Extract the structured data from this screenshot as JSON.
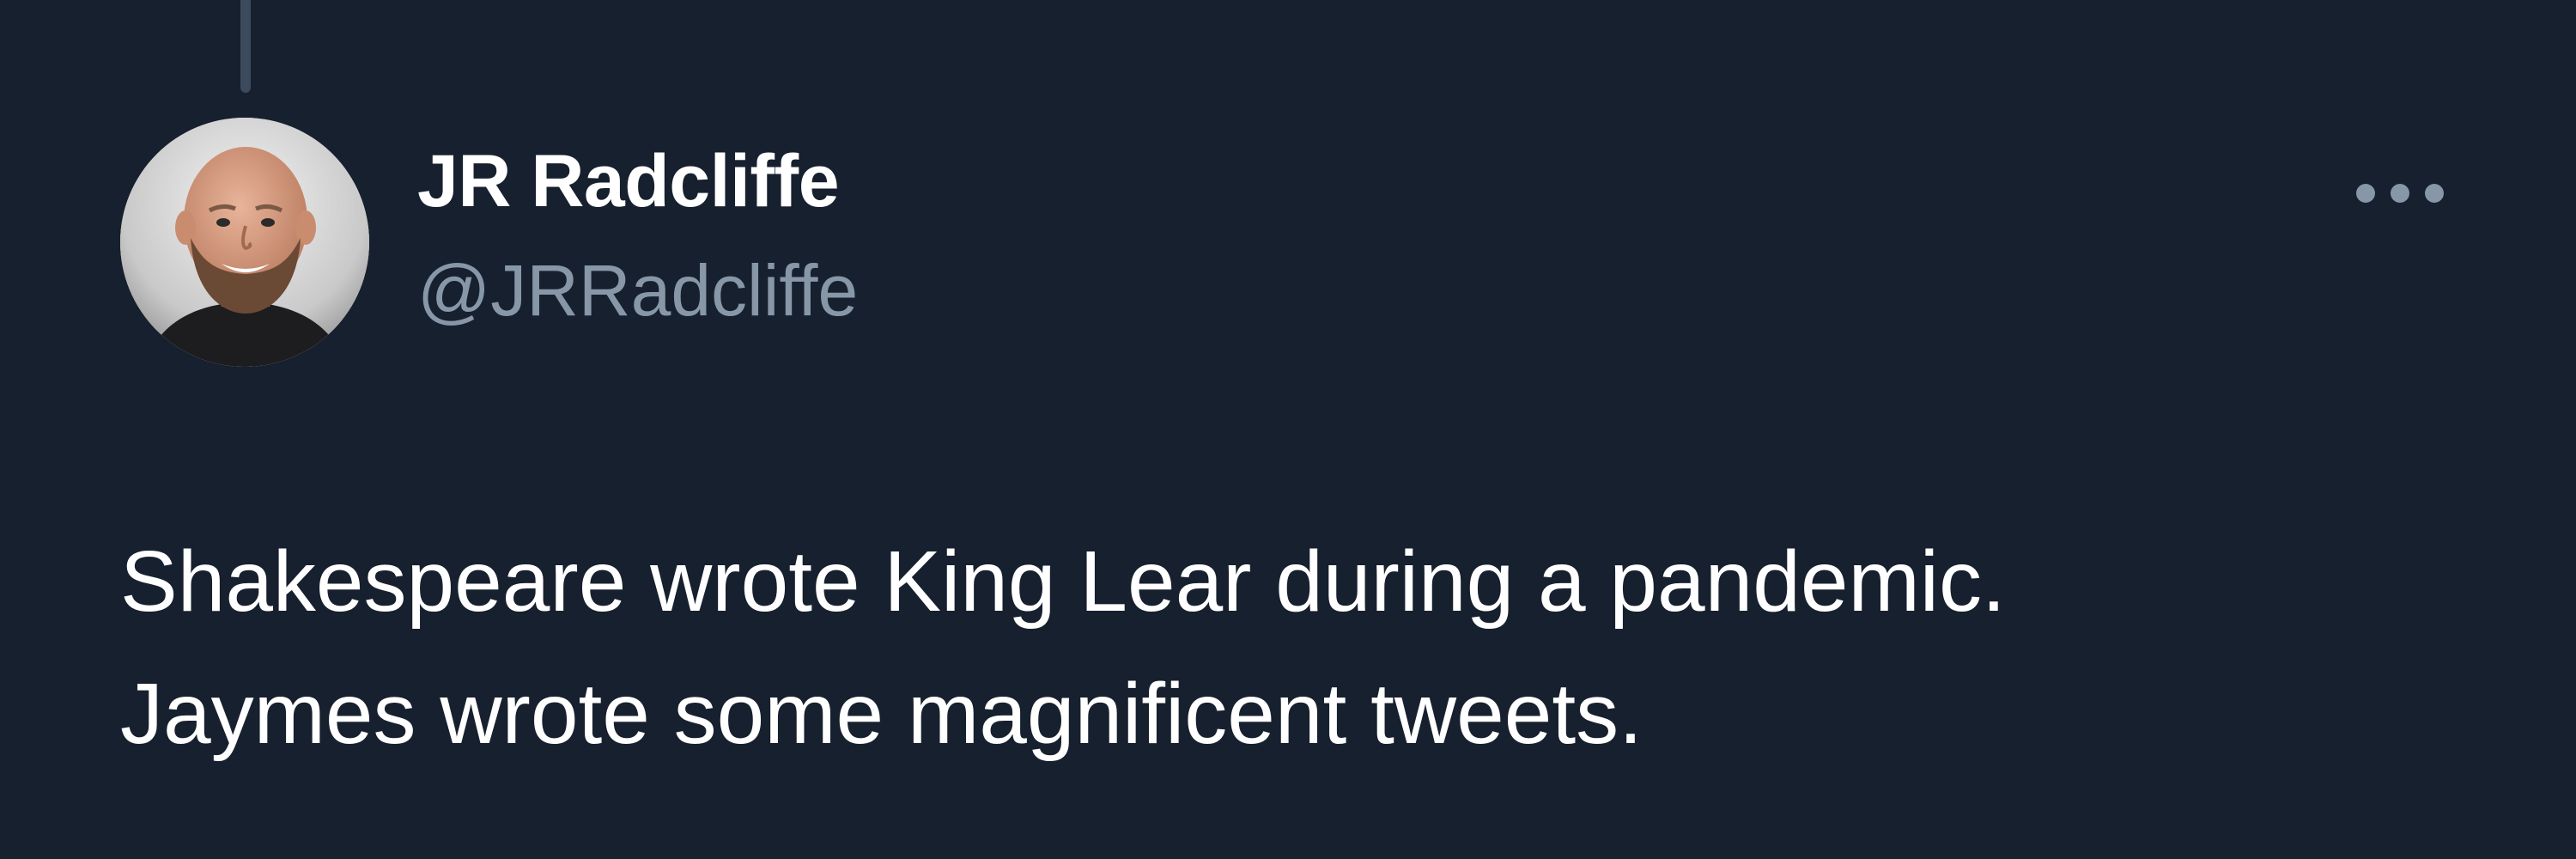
{
  "tweet": {
    "author": {
      "display_name": "JR Radcliffe",
      "handle": "@JRRadcliffe",
      "avatar_icon": "profile-photo"
    },
    "more_icon": "more-horizontal-icon",
    "text_lines": [
      "Shakespeare wrote King Lear during a pandemic.",
      "Jaymes wrote some magnificent tweets."
    ]
  },
  "colors": {
    "background": "#17202e",
    "text_primary": "#ffffff",
    "text_secondary": "#8797a8",
    "thread_line": "#3b4a5d"
  }
}
